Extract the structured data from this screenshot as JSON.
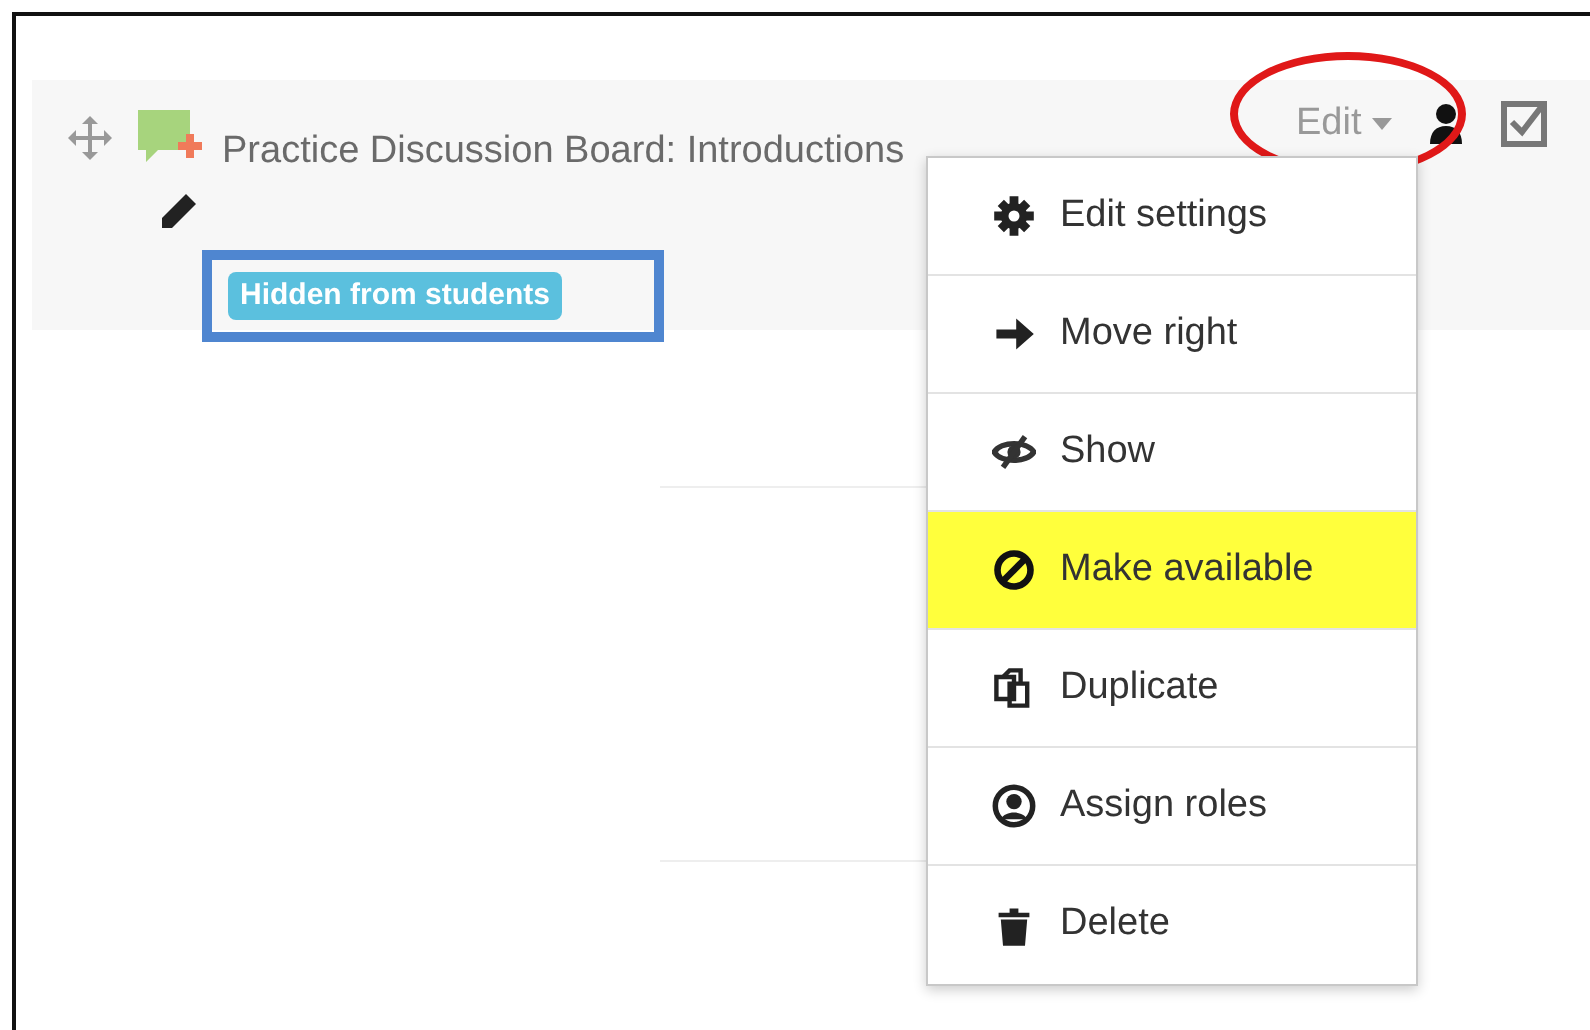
{
  "activity": {
    "title": "Practice Discussion Board: Introductions",
    "badge": "Hidden from students",
    "edit_label": "Edit"
  },
  "menu": [
    {
      "label": "Edit settings",
      "kind": "gear",
      "selected": false
    },
    {
      "label": "Move right",
      "kind": "arrow",
      "selected": false
    },
    {
      "label": "Show",
      "kind": "eye",
      "selected": false
    },
    {
      "label": "Make available",
      "kind": "ban",
      "selected": true
    },
    {
      "label": "Duplicate",
      "kind": "copy",
      "selected": false
    },
    {
      "label": "Assign roles",
      "kind": "user",
      "selected": false
    },
    {
      "label": "Delete",
      "kind": "trash",
      "selected": false
    }
  ]
}
